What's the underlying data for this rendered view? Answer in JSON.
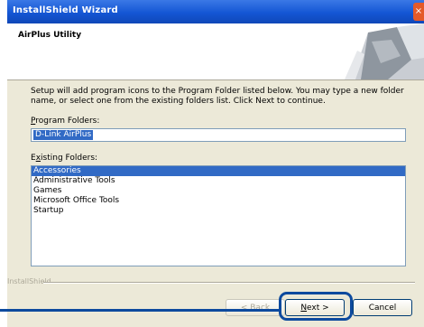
{
  "window": {
    "title": "InstallShield Wizard",
    "close_glyph": "×"
  },
  "header": {
    "title": "AirPlus Utility"
  },
  "description": "Setup will add program icons to the Program Folder listed below. You may type a new folder name, or select one from the existing folders list. Click Next to continue.",
  "program_folder": {
    "label_accel": "P",
    "label_rest": "rogram Folders:",
    "value": "D-Link AirPlus"
  },
  "existing_folders": {
    "label_pre": "E",
    "label_accel": "x",
    "label_rest": "isting Folders:",
    "items": [
      "Accessories",
      "Administrative Tools",
      "Games",
      "Microsoft Office Tools",
      "Startup"
    ],
    "selected": "Accessories"
  },
  "footer": {
    "brand": "InstallShield",
    "back_label": "< Back",
    "next_accel": "N",
    "next_rest": "ext >",
    "cancel_label": "Cancel"
  }
}
